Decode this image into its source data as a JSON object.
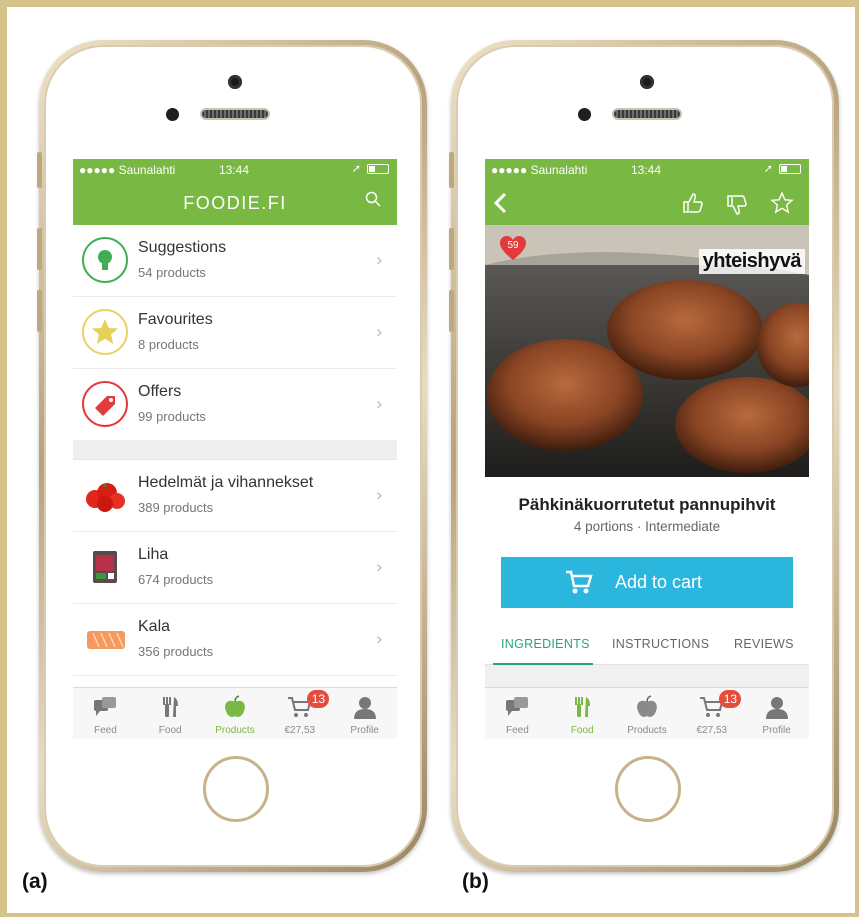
{
  "captions": {
    "a": "(a)",
    "b": "(b)"
  },
  "status": {
    "carrier": "●●●●● Saunalahti",
    "time": "13:44"
  },
  "screen_a": {
    "title": "FOODIE.FI",
    "lists": [
      {
        "name": "Suggestions",
        "count": "54 products",
        "icon": "lightbulb-icon"
      },
      {
        "name": "Favourites",
        "count": "8 products",
        "icon": "star-icon"
      },
      {
        "name": "Offers",
        "count": "99 products",
        "icon": "tag-icon"
      }
    ],
    "categories": [
      {
        "name": "Hedelmät ja vihannekset",
        "count": "389 products",
        "icon": "tomatoes-icon"
      },
      {
        "name": "Liha",
        "count": "674 products",
        "icon": "meat-package-icon"
      },
      {
        "name": "Kala",
        "count": "356 products",
        "icon": "fish-fillet-icon"
      }
    ]
  },
  "screen_b": {
    "likes": "59",
    "brand": "yhteishyvä",
    "recipe_title": "Pähkinäkuorrutetut pannupihvit",
    "recipe_meta": "4 portions · Intermediate",
    "add_to_cart": "Add to cart",
    "tabs": [
      "INGREDIENTS",
      "INSTRUCTIONS",
      "REVIEWS"
    ],
    "active_tab": "INGREDIENTS"
  },
  "tabbar": {
    "items": [
      {
        "label": "Feed",
        "icon": "feed-icon"
      },
      {
        "label": "Food",
        "icon": "cutlery-icon"
      },
      {
        "label": "Products",
        "icon": "apple-icon"
      },
      {
        "label": "€27,53",
        "icon": "cart-icon"
      },
      {
        "label": "Profile",
        "icon": "profile-icon"
      }
    ],
    "cart_badge": "13"
  },
  "colors": {
    "brand_green": "#78b843",
    "cta_blue": "#2bb6dd",
    "badge_red": "#e64b3c",
    "tab_active": "#2aa47a"
  }
}
